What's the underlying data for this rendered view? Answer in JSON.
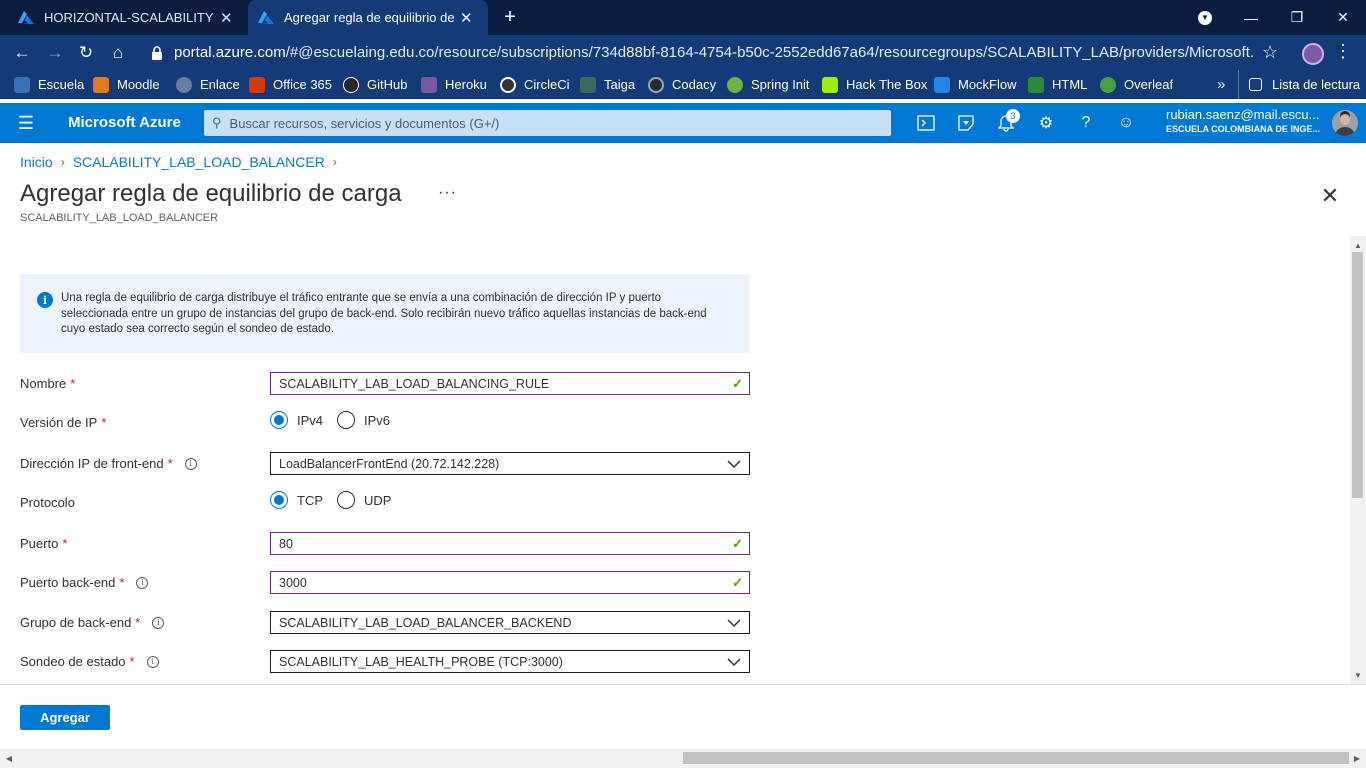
{
  "browser": {
    "tabs": [
      {
        "title": "HORIZONTAL-SCALABILITY - Mic",
        "active": false
      },
      {
        "title": "Agregar regla de equilibrio de ca",
        "active": true
      }
    ],
    "url_host": "portal.azure.com",
    "url_path": "/#@escuelaing.edu.co/resource/subscriptions/734d88bf-8164-4754-b50c-2552edd67a64/resourcegroups/SCALABILITY_LAB/providers/Microsoft.Network/l...",
    "bookmarks": [
      {
        "label": "Escuela",
        "color": "#3b6fb6"
      },
      {
        "label": "Moodle",
        "color": "#e27a1c"
      },
      {
        "label": "Enlace",
        "color": "#6a7fa3"
      },
      {
        "label": "Office 365",
        "color": "#d83b01"
      },
      {
        "label": "GitHub",
        "color": "#24292e"
      },
      {
        "label": "Heroku",
        "color": "#79589f"
      },
      {
        "label": "CircleCi",
        "color": "#343434"
      },
      {
        "label": "Taiga",
        "color": "#3c6a5a"
      },
      {
        "label": "Codacy",
        "color": "#242c33"
      },
      {
        "label": "Spring Init",
        "color": "#6db33f"
      },
      {
        "label": "Hack The Box",
        "color": "#9fef00"
      },
      {
        "label": "MockFlow",
        "color": "#1e88e5"
      },
      {
        "label": "HTML",
        "color": "#2c8a3b"
      },
      {
        "label": "Overleaf",
        "color": "#47a141"
      }
    ],
    "more_bookmarks": "»",
    "reading_list": "Lista de lectura"
  },
  "azure": {
    "brand": "Microsoft Azure",
    "search_placeholder": "Buscar recursos, servicios y documentos (G+/)",
    "notifications_count": "3",
    "account_email": "rubian.saenz@mail.escu...",
    "account_org": "ESCUELA COLOMBIANA DE INGE..."
  },
  "page": {
    "breadcrumb": [
      "Inicio",
      "SCALABILITY_LAB_LOAD_BALANCER"
    ],
    "title": "Agregar regla de equilibrio de carga",
    "more": "···",
    "subtitle": "SCALABILITY_LAB_LOAD_BALANCER",
    "info": "Una regla de equilibrio de carga distribuye el tráfico entrante que se envía a una combinación de dirección IP y puerto seleccionada entre un grupo de instancias del grupo de back-end. Solo recibirán nuevo tráfico aquellas instancias de back-end cuyo estado sea correcto según el sondeo de estado."
  },
  "form": {
    "name": {
      "label": "Nombre",
      "required": "*",
      "value": "SCALABILITY_LAB_LOAD_BALANCING_RULE"
    },
    "ip_version": {
      "label": "Versión de IP",
      "required": "*",
      "options": [
        "IPv4",
        "IPv6"
      ],
      "selected": "IPv4"
    },
    "frontend_ip": {
      "label": "Dirección IP de front-end",
      "required": "*",
      "value": "LoadBalancerFrontEnd (20.72.142.228)"
    },
    "protocol": {
      "label": "Protocolo",
      "options": [
        "TCP",
        "UDP"
      ],
      "selected": "TCP"
    },
    "port": {
      "label": "Puerto",
      "required": "*",
      "value": "80"
    },
    "backend_port": {
      "label": "Puerto back-end",
      "required": "*",
      "value": "3000"
    },
    "backend_pool": {
      "label": "Grupo de back-end",
      "required": "*",
      "value": "SCALABILITY_LAB_LOAD_BALANCER_BACKEND"
    },
    "health_probe": {
      "label": "Sondeo de estado",
      "required": "*",
      "value": "SCALABILITY_LAB_HEALTH_PROBE (TCP:3000)"
    }
  },
  "footer": {
    "add_label": "Agregar"
  },
  "colors": {
    "accent": "#0078d4",
    "browser_dark": "#0b1d3e",
    "browser_nav": "#143a78",
    "valid_border": "#6f2a7e",
    "valid_check": "#57a300",
    "required": "#a4262c"
  }
}
